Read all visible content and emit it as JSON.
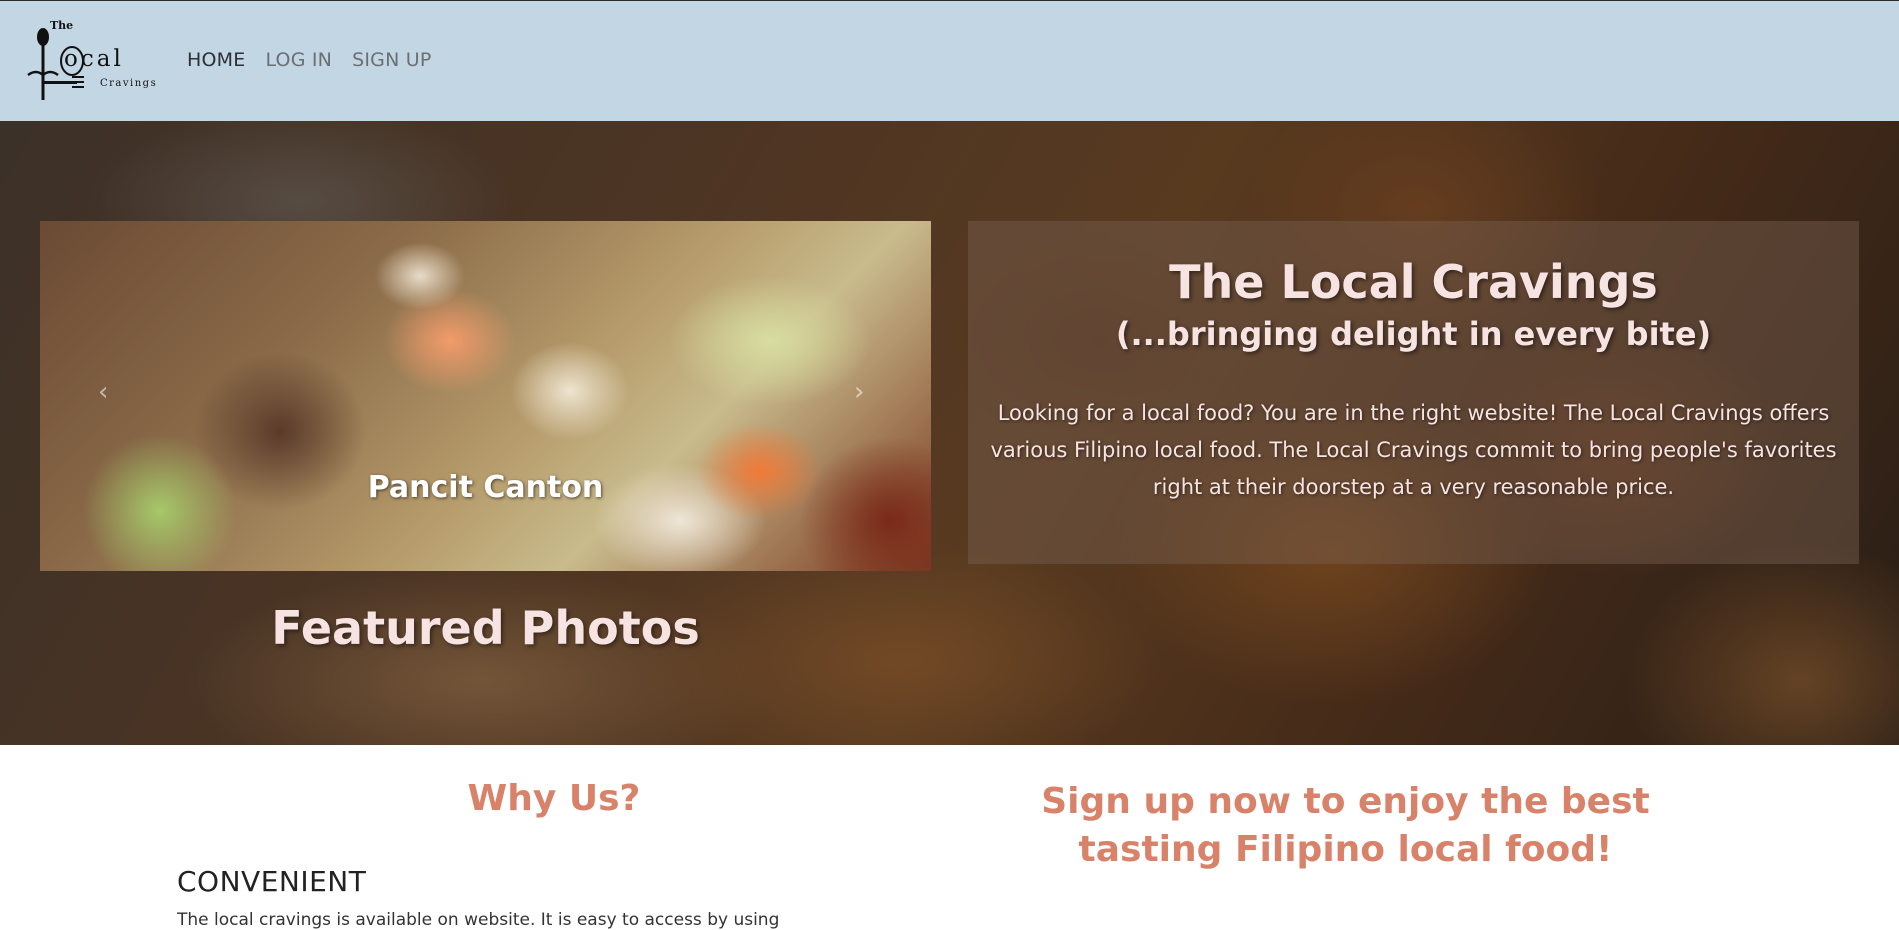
{
  "logo": {
    "the": "The",
    "ocal": "ocal",
    "cravings": "Cravings"
  },
  "nav": {
    "items": [
      {
        "label": "HOME",
        "active": true
      },
      {
        "label": "LOG IN",
        "active": false
      },
      {
        "label": "SIGN UP",
        "active": false
      }
    ]
  },
  "carousel": {
    "caption": "Pancit Canton",
    "prev_icon": "chevron-left-icon",
    "next_icon": "chevron-right-icon"
  },
  "featured": {
    "title": "Featured Photos"
  },
  "intro": {
    "title": "The Local Cravings",
    "subtitle": "(...bringing delight in every bite)",
    "body": "Looking for a local food? You are in the right website! The Local Cravings offers various Filipino local food. The Local Cravings commit to bring people's favorites right at their doorstep at a very reasonable price."
  },
  "why_us": {
    "title": "Why Us?",
    "features": [
      {
        "heading": "CONVENIENT",
        "text": "The local cravings is available on website. It is easy to access by using"
      }
    ]
  },
  "signup_cta": {
    "text": "Sign up now to enjoy the best tasting Filipino local food!"
  },
  "colors": {
    "navbar": "#c3d6e4",
    "accent": "#d9826a",
    "hero_text": "#f7e4e2"
  }
}
